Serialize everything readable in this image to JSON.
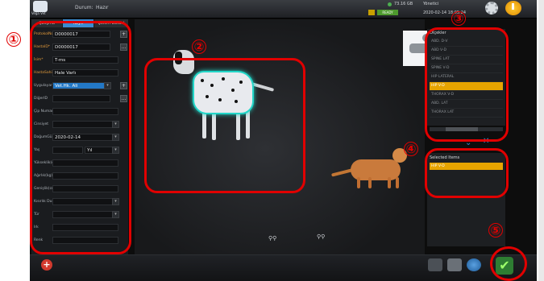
{
  "topbar": {
    "logo_text": "Vega Vet",
    "status_label": "Durum:",
    "status_value": "Hazır",
    "disk": "73.16 GB",
    "user": "Yönetici",
    "datetime": "2020-02-14 18:05:24",
    "ready": "READY"
  },
  "left_panel": {
    "tabs": [
      "Çalışma",
      "Kayıt",
      "Çekim Listesi"
    ],
    "fields": [
      {
        "label": "ProtokolNo*",
        "value": "D0000017",
        "required": true,
        "button": "+"
      },
      {
        "label": "HastaID*",
        "value": "D0000017",
        "required": true,
        "button": "..."
      },
      {
        "label": "İsim*",
        "value": "T-ms",
        "required": true
      },
      {
        "label": "HastaSahibi*",
        "value": "Hale Varlı",
        "required": true
      },
      {
        "label": "Uygulayan",
        "value": "Vet.Hk. Ali",
        "selected": true,
        "dropdown": true,
        "button": "+"
      },
      {
        "label": "DiğerID",
        "value": "",
        "button": "..."
      },
      {
        "label": "Çip Numarası",
        "value": ""
      },
      {
        "label": "Cinsiyet",
        "value": "",
        "dropdown": true
      },
      {
        "label": "DoğumGünü",
        "value": "2020-02-14",
        "dropdown": true
      },
      {
        "label": "Yaş",
        "value": "",
        "unit": "Yıl",
        "dropdown": true
      },
      {
        "label": "Yükseklik(cm)",
        "value": ""
      },
      {
        "label": "Ağırlık(kg)",
        "value": ""
      },
      {
        "label": "Genişlik(cm)",
        "value": ""
      },
      {
        "label": "Kısırlık Durumu",
        "value": "",
        "dropdown": true
      },
      {
        "label": "Tür",
        "value": "",
        "dropdown": true
      },
      {
        "label": "Irk",
        "value": ""
      },
      {
        "label": "Renk",
        "value": ""
      }
    ]
  },
  "procedures": {
    "title": "Ölçekler",
    "items": [
      "ABD. D-V",
      "ABD V-D",
      "SPINE LAT",
      "SPINE V-D",
      "HIP LATERAL",
      "HIP V-D",
      "THORAX V-D",
      "ABD. LAT",
      "THORAX LAT"
    ],
    "selected_index": 5
  },
  "selected_items": {
    "title": "Selected Items",
    "items": [
      "HIP V-D"
    ]
  },
  "annotations": [
    "①",
    "②",
    "③",
    "④",
    "⑤"
  ],
  "colors": {
    "accent": "#3a8bd0",
    "highlight": "#e7a400",
    "annotation": "#e10000",
    "outline": "#22d6c8"
  },
  "icons": {
    "settings": "gear-icon",
    "power": "power-icon",
    "add": "add-icon",
    "confirm": "checkmark-icon"
  }
}
